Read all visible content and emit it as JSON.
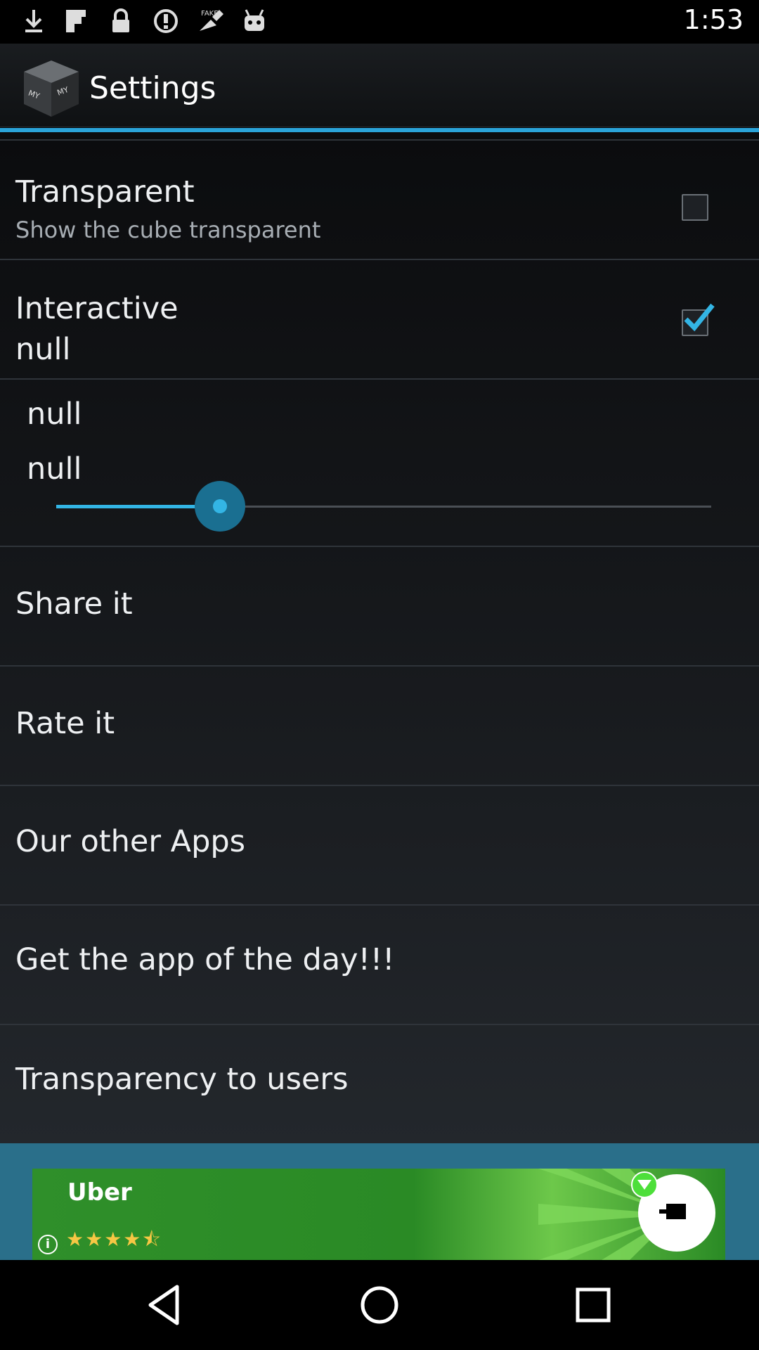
{
  "status_bar": {
    "time": "1:53",
    "icons": [
      "download-icon",
      "flipboard-icon",
      "lock-icon",
      "alert-icon",
      "fake-gps-icon",
      "android-icon"
    ]
  },
  "action_bar": {
    "title": "Settings",
    "app_icon": "cube-icon",
    "accent_color": "#2aa3d8"
  },
  "preferences": {
    "transparent": {
      "title": "Transparent",
      "summary": "Show the cube transparent",
      "checked": false
    },
    "interactive": {
      "title": "Interactive",
      "summary": "null",
      "checked": true
    },
    "slider_pref": {
      "title": "null",
      "label": "null",
      "value_fraction": 0.25
    },
    "share": {
      "title": "Share it"
    },
    "rate": {
      "title": "Rate it"
    },
    "other_apps": {
      "title": "Our other Apps"
    },
    "app_of_day": {
      "title": "Get the app of the day!!!"
    },
    "transparency_users": {
      "title": "Transparency to users"
    }
  },
  "ad": {
    "title": "Uber",
    "rating_stars": "★★★★⯪",
    "rating": 4.5,
    "info_glyph": "i",
    "icons": [
      "info-icon",
      "uber-logo-icon",
      "download-badge-icon"
    ]
  },
  "nav_bar": {
    "icons": [
      "back-icon",
      "home-icon",
      "recents-icon"
    ]
  },
  "colors": {
    "checkbox_check": "#33b5e5",
    "slider": "#33b5e5",
    "ad_green": "#2f8f2a"
  }
}
